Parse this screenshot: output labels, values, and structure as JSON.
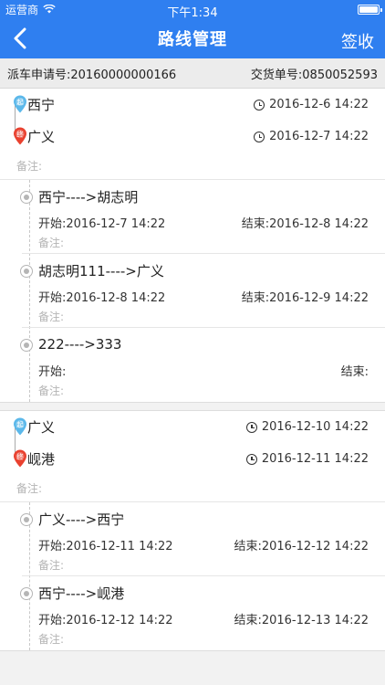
{
  "status": {
    "carrier": "运营商",
    "time": "下午1:34"
  },
  "nav": {
    "title": "路线管理",
    "action": "签收"
  },
  "info": {
    "dispatch_label": "派车申请号:",
    "dispatch_no": "20160000000166",
    "delivery_label": "交货单号:",
    "delivery_no": "0850052593"
  },
  "labels": {
    "remark": "备注:",
    "start": "开始:",
    "end": "结束:",
    "start_pin": "起",
    "end_pin": "终"
  },
  "colors": {
    "primary": "#2f7ff0",
    "start_pin": "#5bb8ea",
    "end_pin": "#e9412f"
  },
  "routes": [
    {
      "from": "西宁",
      "from_time": "2016-12-6 14:22",
      "to": "广义",
      "to_time": "2016-12-7 14:22",
      "segments": [
        {
          "title": "西宁---->胡志明",
          "start": "2016-12-7 14:22",
          "end": "2016-12-8 14:22"
        },
        {
          "title": "胡志明111---->广义",
          "start": "2016-12-8 14:22",
          "end": "2016-12-9 14:22"
        },
        {
          "title": "222---->333",
          "start": "",
          "end": ""
        }
      ]
    },
    {
      "from": "广义",
      "from_time": "2016-12-10 14:22",
      "to": "岘港",
      "to_time": "2016-12-11 14:22",
      "segments": [
        {
          "title": "广义---->西宁",
          "start": "2016-12-11 14:22",
          "end": "2016-12-12 14:22"
        },
        {
          "title": "西宁---->岘港",
          "start": "2016-12-12 14:22",
          "end": "2016-12-13 14:22"
        }
      ]
    }
  ]
}
